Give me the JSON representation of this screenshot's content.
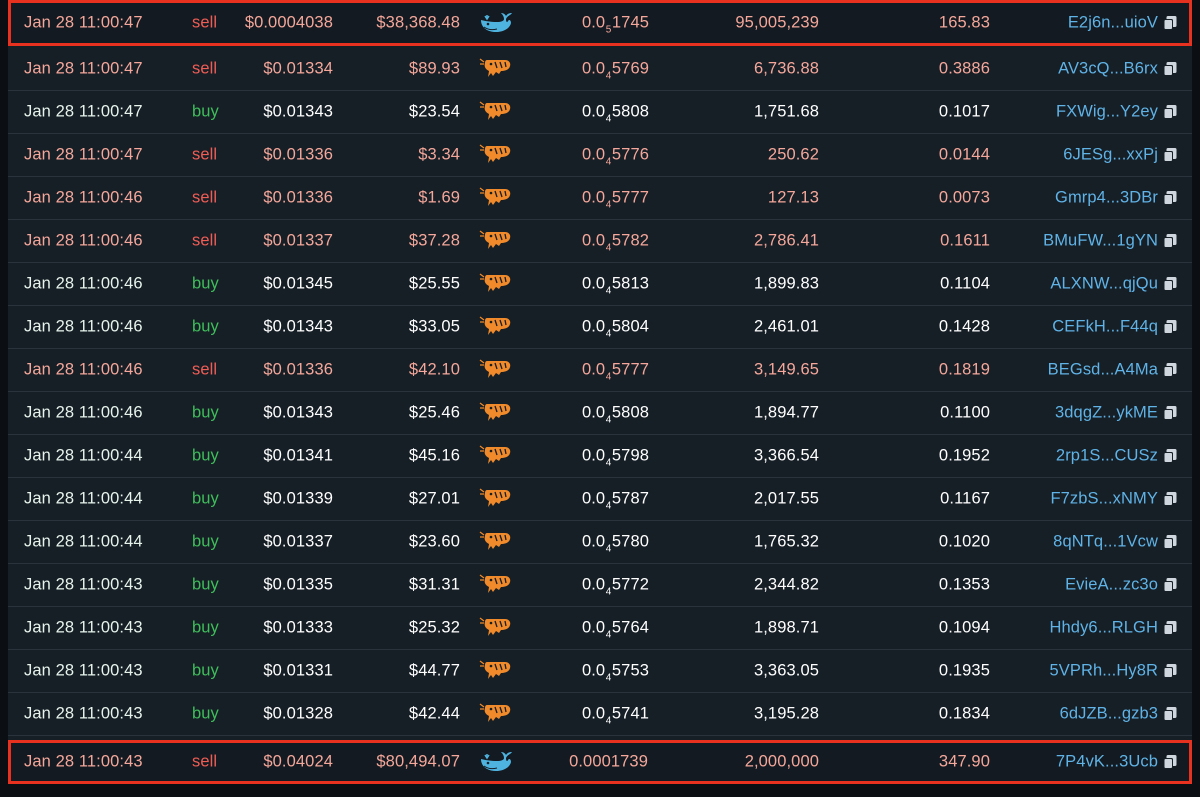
{
  "colors": {
    "buy": "#3fbf5a",
    "sell": "#ef5d55",
    "maker_link": "#5fb3e6",
    "highlight_border": "#e8321f",
    "shrimp_icon": "#f08a2a",
    "whale_icon": "#4fb3e0"
  },
  "icons": {
    "whale": "whale-icon",
    "shrimp": "shrimp-icon",
    "copy": "copy-icon"
  },
  "rows": [
    {
      "time": "Jan 28 11:00:47",
      "side": "sell",
      "price": "$0.0004038",
      "usd": "$38,368.48",
      "icon": "whale",
      "tp_pre": "0.0",
      "tp_sub": "5",
      "tp_post": "1745",
      "amount": "95,005,239",
      "sol": "165.83",
      "maker": "E2j6n...uioV",
      "highlight": true
    },
    {
      "time": "Jan 28 11:00:47",
      "side": "sell",
      "price": "$0.01334",
      "usd": "$89.93",
      "icon": "shrimp",
      "tp_pre": "0.0",
      "tp_sub": "4",
      "tp_post": "5769",
      "amount": "6,736.88",
      "sol": "0.3886",
      "maker": "AV3cQ...B6rx",
      "highlight": false
    },
    {
      "time": "Jan 28 11:00:47",
      "side": "buy",
      "price": "$0.01343",
      "usd": "$23.54",
      "icon": "shrimp",
      "tp_pre": "0.0",
      "tp_sub": "4",
      "tp_post": "5808",
      "amount": "1,751.68",
      "sol": "0.1017",
      "maker": "FXWig...Y2ey",
      "highlight": false
    },
    {
      "time": "Jan 28 11:00:47",
      "side": "sell",
      "price": "$0.01336",
      "usd": "$3.34",
      "icon": "shrimp",
      "tp_pre": "0.0",
      "tp_sub": "4",
      "tp_post": "5776",
      "amount": "250.62",
      "sol": "0.0144",
      "maker": "6JESg...xxPj",
      "highlight": false
    },
    {
      "time": "Jan 28 11:00:46",
      "side": "sell",
      "price": "$0.01336",
      "usd": "$1.69",
      "icon": "shrimp",
      "tp_pre": "0.0",
      "tp_sub": "4",
      "tp_post": "5777",
      "amount": "127.13",
      "sol": "0.0073",
      "maker": "Gmrp4...3DBr",
      "highlight": false
    },
    {
      "time": "Jan 28 11:00:46",
      "side": "sell",
      "price": "$0.01337",
      "usd": "$37.28",
      "icon": "shrimp",
      "tp_pre": "0.0",
      "tp_sub": "4",
      "tp_post": "5782",
      "amount": "2,786.41",
      "sol": "0.1611",
      "maker": "BMuFW...1gYN",
      "highlight": false
    },
    {
      "time": "Jan 28 11:00:46",
      "side": "buy",
      "price": "$0.01345",
      "usd": "$25.55",
      "icon": "shrimp",
      "tp_pre": "0.0",
      "tp_sub": "4",
      "tp_post": "5813",
      "amount": "1,899.83",
      "sol": "0.1104",
      "maker": "ALXNW...qjQu",
      "highlight": false
    },
    {
      "time": "Jan 28 11:00:46",
      "side": "buy",
      "price": "$0.01343",
      "usd": "$33.05",
      "icon": "shrimp",
      "tp_pre": "0.0",
      "tp_sub": "4",
      "tp_post": "5804",
      "amount": "2,461.01",
      "sol": "0.1428",
      "maker": "CEFkH...F44q",
      "highlight": false
    },
    {
      "time": "Jan 28 11:00:46",
      "side": "sell",
      "price": "$0.01336",
      "usd": "$42.10",
      "icon": "shrimp",
      "tp_pre": "0.0",
      "tp_sub": "4",
      "tp_post": "5777",
      "amount": "3,149.65",
      "sol": "0.1819",
      "maker": "BEGsd...A4Ma",
      "highlight": false
    },
    {
      "time": "Jan 28 11:00:46",
      "side": "buy",
      "price": "$0.01343",
      "usd": "$25.46",
      "icon": "shrimp",
      "tp_pre": "0.0",
      "tp_sub": "4",
      "tp_post": "5808",
      "amount": "1,894.77",
      "sol": "0.1100",
      "maker": "3dqgZ...ykME",
      "highlight": false
    },
    {
      "time": "Jan 28 11:00:44",
      "side": "buy",
      "price": "$0.01341",
      "usd": "$45.16",
      "icon": "shrimp",
      "tp_pre": "0.0",
      "tp_sub": "4",
      "tp_post": "5798",
      "amount": "3,366.54",
      "sol": "0.1952",
      "maker": "2rp1S...CUSz",
      "highlight": false
    },
    {
      "time": "Jan 28 11:00:44",
      "side": "buy",
      "price": "$0.01339",
      "usd": "$27.01",
      "icon": "shrimp",
      "tp_pre": "0.0",
      "tp_sub": "4",
      "tp_post": "5787",
      "amount": "2,017.55",
      "sol": "0.1167",
      "maker": "F7zbS...xNMY",
      "highlight": false
    },
    {
      "time": "Jan 28 11:00:44",
      "side": "buy",
      "price": "$0.01337",
      "usd": "$23.60",
      "icon": "shrimp",
      "tp_pre": "0.0",
      "tp_sub": "4",
      "tp_post": "5780",
      "amount": "1,765.32",
      "sol": "0.1020",
      "maker": "8qNTq...1Vcw",
      "highlight": false
    },
    {
      "time": "Jan 28 11:00:43",
      "side": "buy",
      "price": "$0.01335",
      "usd": "$31.31",
      "icon": "shrimp",
      "tp_pre": "0.0",
      "tp_sub": "4",
      "tp_post": "5772",
      "amount": "2,344.82",
      "sol": "0.1353",
      "maker": "EvieA...zc3o",
      "highlight": false
    },
    {
      "time": "Jan 28 11:00:43",
      "side": "buy",
      "price": "$0.01333",
      "usd": "$25.32",
      "icon": "shrimp",
      "tp_pre": "0.0",
      "tp_sub": "4",
      "tp_post": "5764",
      "amount": "1,898.71",
      "sol": "0.1094",
      "maker": "Hhdy6...RLGH",
      "highlight": false
    },
    {
      "time": "Jan 28 11:00:43",
      "side": "buy",
      "price": "$0.01331",
      "usd": "$44.77",
      "icon": "shrimp",
      "tp_pre": "0.0",
      "tp_sub": "4",
      "tp_post": "5753",
      "amount": "3,363.05",
      "sol": "0.1935",
      "maker": "5VPRh...Hy8R",
      "highlight": false
    },
    {
      "time": "Jan 28 11:00:43",
      "side": "buy",
      "price": "$0.01328",
      "usd": "$42.44",
      "icon": "shrimp",
      "tp_pre": "0.0",
      "tp_sub": "4",
      "tp_post": "5741",
      "amount": "3,195.28",
      "sol": "0.1834",
      "maker": "6dJZB...gzb3",
      "highlight": false
    },
    {
      "time": "Jan 28 11:00:43",
      "side": "sell",
      "price": "$0.04024",
      "usd": "$80,494.07",
      "icon": "whale",
      "tp_pre": "0.0001739",
      "tp_sub": "",
      "tp_post": "",
      "amount": "2,000,000",
      "sol": "347.90",
      "maker": "7P4vK...3Ucb",
      "highlight": true
    }
  ]
}
